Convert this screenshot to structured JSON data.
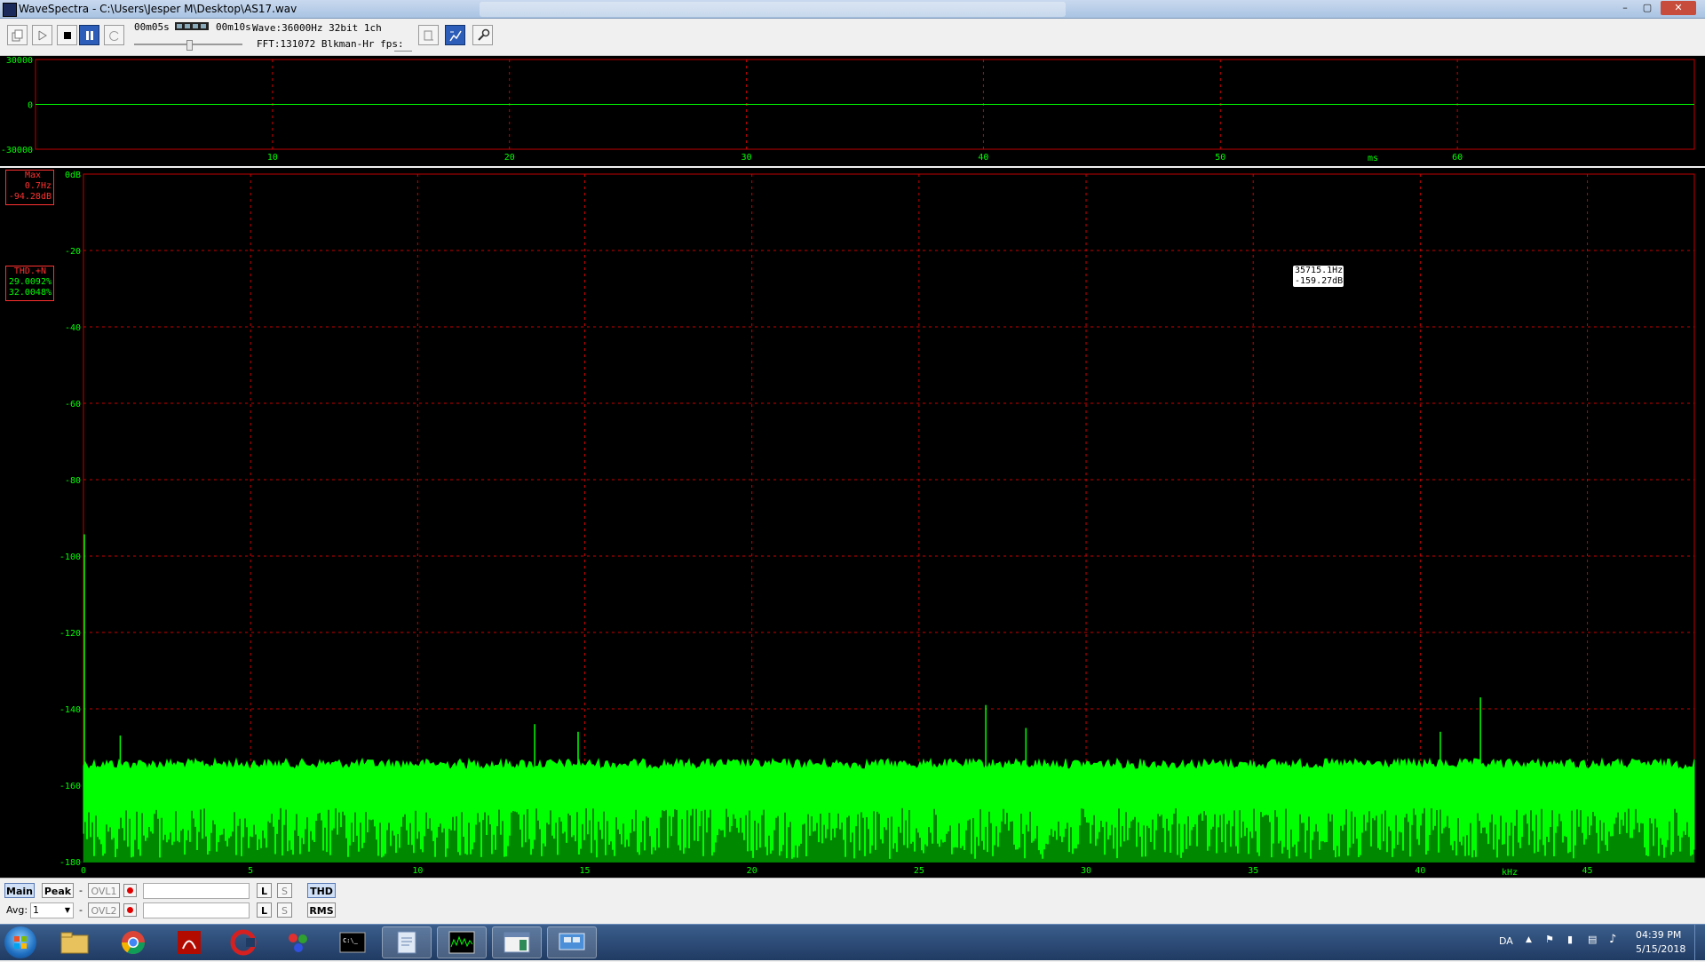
{
  "window": {
    "title": "WaveSpectra - C:\\Users\\Jesper M\\Desktop\\AS17.wav",
    "minimize_glyph": "–",
    "maximize_glyph": "▢",
    "close_glyph": "✕"
  },
  "toolbar": {
    "time_start": "00m05s",
    "time_end": "00m10s",
    "wave_info": "Wave:36000Hz 32bit 1ch",
    "fft_info": "FFT:131072 Blkman-Hr fps:",
    "buttons": [
      "copy-icon",
      "play-icon",
      "stop-icon",
      "pause-icon",
      "repeat-icon",
      "record-monitor-icon",
      "hz-scale-icon",
      "settings-icon"
    ]
  },
  "waveform": {
    "y_ticks": [
      "30000",
      "0",
      "-30000"
    ],
    "x_ticks": [
      "10",
      "20",
      "30",
      "40",
      "50",
      "60"
    ],
    "x_unit": "ms"
  },
  "spectrum": {
    "max_box": {
      "title": "Max",
      "freq": "0.7Hz",
      "level": "-94.28dB"
    },
    "thd_box": {
      "title": "THD.+N",
      "value1": "29.0092%",
      "value2": "32.0048%"
    },
    "cursor": {
      "freq": "35715.1Hz",
      "level": "-159.27dB"
    }
  },
  "chart_data": [
    {
      "type": "line",
      "title": "",
      "xlabel": "ms",
      "ylabel": "",
      "x_ticks": [
        "10",
        "20",
        "30",
        "40",
        "50",
        "60"
      ],
      "xlim": [
        0,
        70
      ],
      "ylim": [
        -30000,
        30000
      ],
      "y_ticks": [
        "30000",
        "0",
        "-30000"
      ],
      "series": [
        {
          "values": [
            0,
            0
          ]
        }
      ],
      "grid": true
    },
    {
      "type": "area",
      "title": "",
      "xlabel": "kHz",
      "ylabel": "",
      "y_unit_label": "0dB",
      "xlim": [
        0,
        48.2
      ],
      "ylim": [
        -180,
        0
      ],
      "x_ticks": [
        "0",
        "5",
        "10",
        "15",
        "20",
        "25",
        "30",
        "35",
        "40",
        "45"
      ],
      "y_ticks": [
        "0dB",
        "-20",
        "-40",
        "-60",
        "-80",
        "-100",
        "-120",
        "-140",
        "-160",
        "-180"
      ],
      "noise_floor_top_db": -154,
      "noise_floor_min_db": -166,
      "peaks": [
        {
          "khz": 0.0,
          "db": -94.3
        },
        {
          "khz": 1.1,
          "db": -147
        },
        {
          "khz": 13.5,
          "db": -144
        },
        {
          "khz": 14.8,
          "db": -146
        },
        {
          "khz": 27.0,
          "db": -139
        },
        {
          "khz": 28.2,
          "db": -145
        },
        {
          "khz": 40.6,
          "db": -146
        },
        {
          "khz": 41.8,
          "db": -137
        }
      ],
      "grid": true
    }
  ],
  "bottom": {
    "main": "Main",
    "peak": "Peak",
    "dash": "-",
    "ovl1": "OVL1",
    "ovl2": "OVL2",
    "l": "L",
    "s": "S",
    "thd": "THD",
    "rms": "RMS",
    "avg_label": "Avg:",
    "avg_value": "1"
  },
  "taskbar": {
    "apps": [
      "explorer",
      "chrome",
      "acrobat",
      "ccleaner",
      "paint",
      "cmd",
      "notepad",
      "wavespectra",
      "window-app",
      "remote"
    ],
    "lang": "DA",
    "time": "04:39 PM",
    "date": "5/15/2018"
  },
  "colors": {
    "grid": "#cc0000",
    "trace": "#00ff00",
    "axis_text": "#00ff00",
    "frame": "#c00000",
    "box_border": "#ff3030"
  }
}
